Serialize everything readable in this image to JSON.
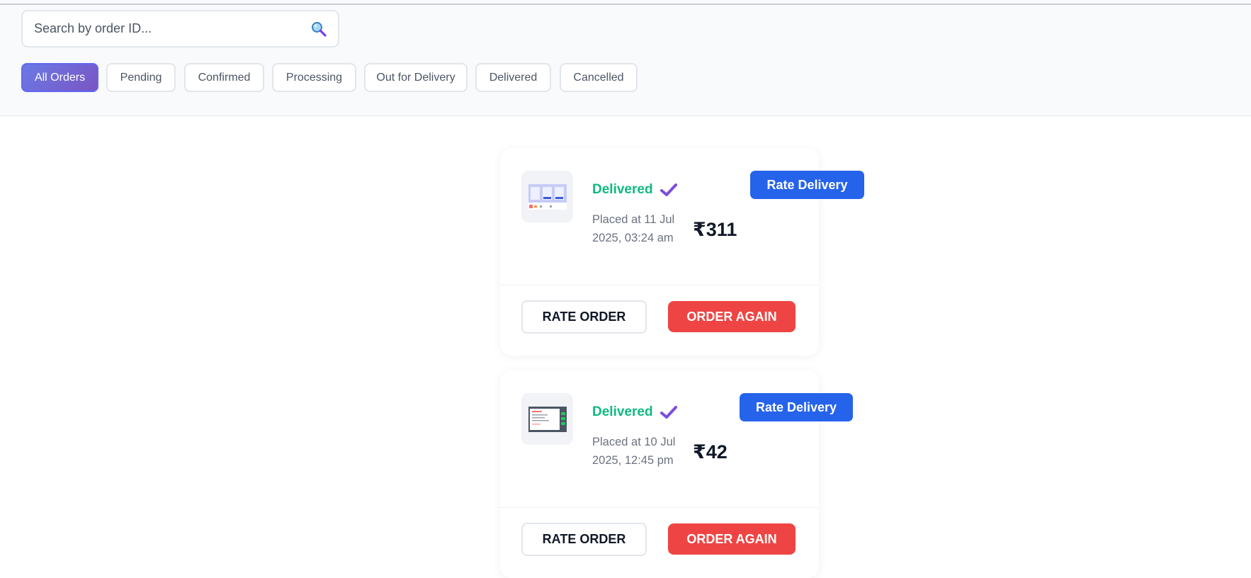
{
  "search": {
    "placeholder": "Search by order ID..."
  },
  "filters": [
    {
      "label": "All Orders",
      "active": true
    },
    {
      "label": "Pending",
      "active": false
    },
    {
      "label": "Confirmed",
      "active": false
    },
    {
      "label": "Processing",
      "active": false
    },
    {
      "label": "Out for Delivery",
      "active": false
    },
    {
      "label": "Delivered",
      "active": false
    },
    {
      "label": "Cancelled",
      "active": false
    }
  ],
  "orders": [
    {
      "status": "Delivered",
      "placed_line1": "Placed at 11 Jul",
      "placed_line2": "2025, 03:24 am",
      "price": "₹311",
      "rate_delivery_label": "Rate Delivery",
      "rate_order_label": "RATE ORDER",
      "order_again_label": "ORDER AGAIN"
    },
    {
      "status": "Delivered",
      "placed_line1": "Placed at 10 Jul",
      "placed_line2": "2025, 12:45 pm",
      "price": "₹42",
      "rate_delivery_label": "Rate Delivery",
      "rate_order_label": "RATE ORDER",
      "order_again_label": "ORDER AGAIN"
    }
  ],
  "colors": {
    "accent": "#6a7ae6",
    "delivered": "#10b981",
    "rate_delivery": "#2563eb",
    "order_again": "#ef4444",
    "check": "#7c4ddb"
  },
  "icons": {
    "search": "magnifier-icon",
    "status": "check-icon"
  }
}
